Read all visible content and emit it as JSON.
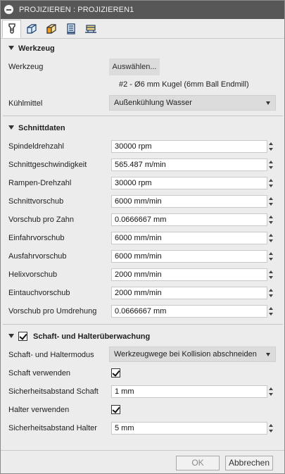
{
  "window": {
    "title": "PROJIZIEREN : PROJIZIEREN1"
  },
  "tabs": [
    {
      "icon": "tool-icon",
      "active": true
    },
    {
      "icon": "geometry-icon",
      "active": false
    },
    {
      "icon": "heights-icon",
      "active": false
    },
    {
      "icon": "passes-icon",
      "active": false
    },
    {
      "icon": "linking-icon",
      "active": false
    }
  ],
  "werkzeug": {
    "title": "Werkzeug",
    "tool_label": "Werkzeug",
    "select_button": "Auswählen...",
    "tool_info": "#2 - Ø6 mm Kugel (6mm Ball Endmill)",
    "coolant_label": "Kühlmittel",
    "coolant_value": "Außenkühlung Wasser"
  },
  "schnittdaten": {
    "title": "Schnittdaten",
    "fields": [
      {
        "label": "Spindeldrehzahl",
        "value": "30000 rpm"
      },
      {
        "label": "Schnittgeschwindigkeit",
        "value": "565.487 m/min"
      },
      {
        "label": "Rampen-Drehzahl",
        "value": "30000 rpm"
      },
      {
        "label": "Schnittvorschub",
        "value": "6000 mm/min"
      },
      {
        "label": "Vorschub pro Zahn",
        "value": "0.0666667 mm"
      },
      {
        "label": "Einfahrvorschub",
        "value": "6000 mm/min"
      },
      {
        "label": "Ausfahrvorschub",
        "value": "6000 mm/min"
      },
      {
        "label": "Helixvorschub",
        "value": "2000 mm/min"
      },
      {
        "label": "Eintauchvorschub",
        "value": "2000 mm/min"
      },
      {
        "label": "Vorschub pro Umdrehung",
        "value": "0.0666667 mm"
      }
    ]
  },
  "schaft": {
    "title": "Schaft- und Halterüberwachung",
    "enabled": true,
    "mode_label": "Schaft- und Haltermodus",
    "mode_value": "Werkzeugwege bei Kollision abschneiden",
    "use_shaft_label": "Schaft verwenden",
    "use_shaft": true,
    "shaft_clearance_label": "Sicherheitsabstand Schaft",
    "shaft_clearance_value": "1 mm",
    "use_holder_label": "Halter verwenden",
    "use_holder": true,
    "holder_clearance_label": "Sicherheitsabstand Halter",
    "holder_clearance_value": "5 mm"
  },
  "footer": {
    "ok": "OK",
    "cancel": "Abbrechen"
  }
}
